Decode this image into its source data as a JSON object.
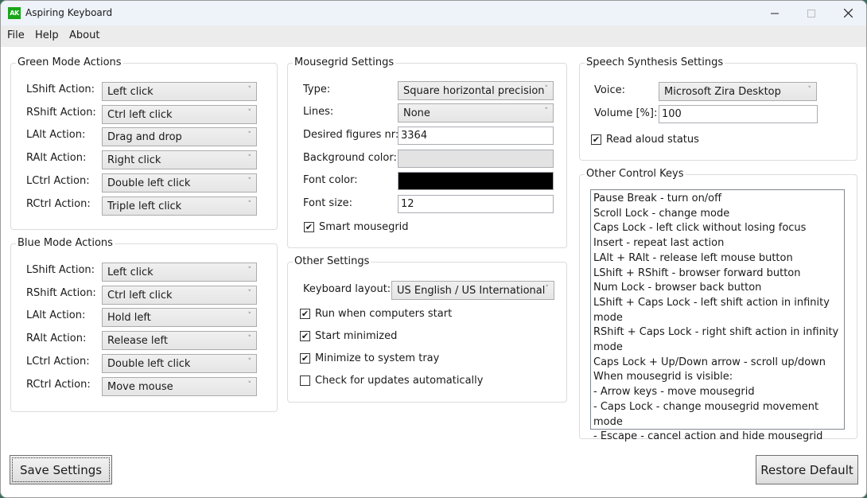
{
  "window": {
    "title": "Aspiring Keyboard",
    "icon_text": "AK",
    "icon_color": "#1aa51a",
    "controls": {
      "minimize": "minimize-icon",
      "maximize": "maximize-icon",
      "close": "close-icon"
    }
  },
  "menu": [
    "File",
    "Help",
    "About"
  ],
  "green_mode": {
    "title": "Green Mode Actions",
    "rows": [
      {
        "label": "LShift Action:",
        "value": "Left click"
      },
      {
        "label": "RShift Action:",
        "value": "Ctrl left click"
      },
      {
        "label": "LAlt Action:",
        "value": "Drag and drop"
      },
      {
        "label": "RAlt Action:",
        "value": "Right click"
      },
      {
        "label": "LCtrl Action:",
        "value": "Double left click"
      },
      {
        "label": "RCtrl Action:",
        "value": "Triple left click"
      }
    ]
  },
  "blue_mode": {
    "title": "Blue Mode Actions",
    "rows": [
      {
        "label": "LShift Action:",
        "value": "Left click"
      },
      {
        "label": "RShift Action:",
        "value": "Ctrl left click"
      },
      {
        "label": "LAlt Action:",
        "value": "Hold left"
      },
      {
        "label": "RAlt Action:",
        "value": "Release left"
      },
      {
        "label": "LCtrl Action:",
        "value": "Double left click"
      },
      {
        "label": "RCtrl Action:",
        "value": "Move mouse"
      }
    ]
  },
  "mousegrid": {
    "title": "Mousegrid Settings",
    "type_label": "Type:",
    "type_value": "Square horizontal precision",
    "lines_label": "Lines:",
    "lines_value": "None",
    "figures_label": "Desired figures nr:",
    "figures_value": "3364",
    "bg_color_label": "Background color:",
    "bg_color_value": "#e3e3e3",
    "font_color_label": "Font color:",
    "font_color_value": "#000000",
    "font_size_label": "Font size:",
    "font_size_value": "12",
    "smart_label": "Smart mousegrid",
    "smart_checked": true
  },
  "other_settings": {
    "title": "Other Settings",
    "layout_label": "Keyboard layout:",
    "layout_value": "US English / US International",
    "checks": [
      {
        "label": "Run when computers start",
        "checked": true
      },
      {
        "label": "Start minimized",
        "checked": true
      },
      {
        "label": "Minimize to system tray",
        "checked": true
      },
      {
        "label": "Check for updates automatically",
        "checked": false
      }
    ]
  },
  "speech": {
    "title": "Speech Synthesis Settings",
    "voice_label": "Voice:",
    "voice_value": "Microsoft Zira Desktop",
    "volume_label": "Volume [%]:",
    "volume_value": "100",
    "read_aloud_label": "Read aloud status",
    "read_aloud_checked": true
  },
  "control_keys": {
    "title": "Other Control Keys",
    "lines": [
      "Pause Break - turn on/off",
      "Scroll Lock - change mode",
      "Caps Lock - left click without losing focus",
      "Insert - repeat last action",
      "LAlt + RAlt - release left mouse button",
      "LShift + RShift - browser forward button",
      "Num Lock - browser back button",
      "LShift + Caps Lock - left shift action in infinity mode",
      "RShift + Caps Lock - right shift action in infinity mode",
      "Caps Lock + Up/Down arrow - scroll up/down",
      "When mousegrid is visible:",
      "- Arrow keys - move mousegrid",
      "- Caps Lock  - change mousegrid movement mode",
      "- Escape - cancel action and hide mousegrid"
    ]
  },
  "buttons": {
    "save": "Save Settings",
    "restore": "Restore Default"
  }
}
